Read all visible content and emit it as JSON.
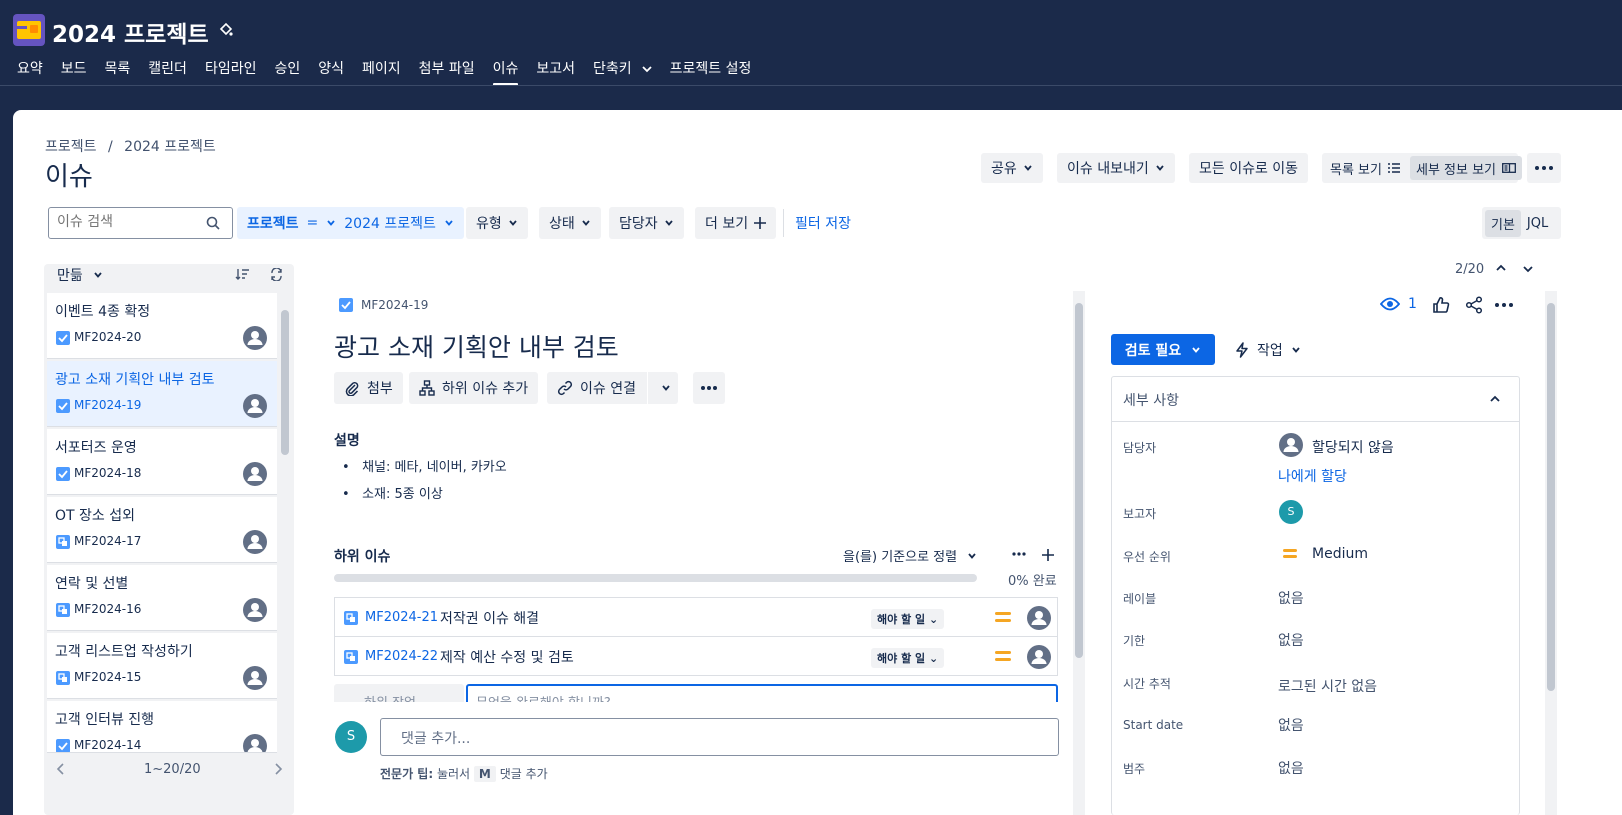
{
  "project": {
    "title": "2024 프로젝트",
    "logo_icon": "project-logo-icon"
  },
  "nav": {
    "items": [
      "요약",
      "보드",
      "목록",
      "캘린더",
      "타임라인",
      "승인",
      "양식",
      "페이지",
      "첨부 파일",
      "이슈",
      "보고서",
      "단축키",
      "프로젝트 설정"
    ],
    "active": "이슈"
  },
  "breadcrumb": {
    "root": "프로젝트",
    "sep": "/",
    "current": "2024 프로젝트"
  },
  "page_title": "이슈",
  "header_actions": {
    "share": "공유",
    "export": "이슈 내보내기",
    "go_all": "모든 이슈로 이동",
    "list_view": "목록 보기",
    "detail_view": "세부 정보 보기"
  },
  "filters": {
    "search_placeholder": "이슈 검색",
    "project_label": "프로젝트",
    "project_op": "=",
    "project_value": "2024 프로젝트",
    "type": "유형",
    "status": "상태",
    "assignee": "담당자",
    "more": "더 보기",
    "save": "필터 저장",
    "mode_basic": "기본",
    "mode_jql": "JQL"
  },
  "list": {
    "sort_label": "만듦",
    "pagination": "1~20/20",
    "items": [
      {
        "title": "이벤트 4종 확정",
        "key": "MF2024-20",
        "type": "task"
      },
      {
        "title": "광고 소재 기획안 내부 검토",
        "key": "MF2024-19",
        "type": "task",
        "selected": true
      },
      {
        "title": "서포터즈 운영",
        "key": "MF2024-18",
        "type": "task"
      },
      {
        "title": "OT 장소 섭외",
        "key": "MF2024-17",
        "type": "subtask"
      },
      {
        "title": "연락 및 선별",
        "key": "MF2024-16",
        "type": "subtask"
      },
      {
        "title": "고객 리스트업 작성하기",
        "key": "MF2024-15",
        "type": "subtask"
      },
      {
        "title": "고객 인터뷰 진행",
        "key": "MF2024-14",
        "type": "task"
      }
    ]
  },
  "issue": {
    "counter": "2/20",
    "key": "MF2024-19",
    "title": "광고 소재 기획안 내부 검토",
    "actions": {
      "attach": "첨부",
      "add_child": "하위 이슈 추가",
      "link": "이슈 연결"
    },
    "description_label": "설명",
    "description_items": [
      "채널: 메타, 네이버, 카카오",
      "소재: 5종 이상"
    ],
    "children_label": "하위 이슈",
    "children_sort": "을(를) 기준으로 정렬",
    "progress_text": "0% 완료",
    "progress": 0,
    "children": [
      {
        "key": "MF2024-21",
        "summary": "저작권 이슈 해결",
        "status": "해야 할 일"
      },
      {
        "key": "MF2024-22",
        "summary": "제작 예산 수정 및 검토",
        "status": "해야 할 일"
      }
    ],
    "child_create_type": "하위 작업",
    "child_create_placeholder": "무엇을 완료해야 합니까?",
    "comment_avatar": "S",
    "comment_placeholder": "댓글 추가...",
    "tip_prefix": "전문가 팁:",
    "tip_middle": "눌러서",
    "tip_key": "M",
    "tip_suffix": "댓글 추가"
  },
  "side": {
    "watchers": "1",
    "status_btn": "검토 필요",
    "action_btn": "작업",
    "details_title": "세부 사항",
    "fields": {
      "assignee_label": "담당자",
      "assignee_value": "할당되지 않음",
      "assign_me": "나에게 할당",
      "reporter_label": "보고자",
      "reporter_avatar": "S",
      "priority_label": "우선 순위",
      "priority_value": "Medium",
      "labels_label": "레이블",
      "labels_value": "없음",
      "due_label": "기한",
      "due_value": "없음",
      "time_label": "시간 추적",
      "time_value": "로그된 시간 없음",
      "start_label": "Start date",
      "start_value": "없음",
      "category_label": "범주",
      "category_value": "없음"
    }
  },
  "colors": {
    "topbar": "#1b2a4a",
    "brand": "#0c66e4",
    "status_btn": "#0c66e4",
    "priority": "#f5a623",
    "avatar_teal": "#1d9aaa"
  }
}
